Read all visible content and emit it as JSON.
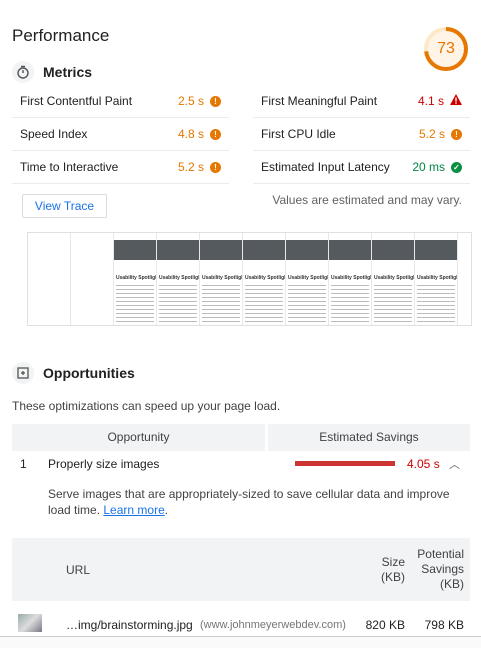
{
  "header": {
    "title": "Performance",
    "score": "73",
    "score_fraction": 0.73,
    "score_color": "#e67700"
  },
  "metrics": {
    "heading": "Metrics",
    "left": [
      {
        "name": "First Contentful Paint",
        "value": "2.5 s",
        "status": "average"
      },
      {
        "name": "Speed Index",
        "value": "4.8 s",
        "status": "average"
      },
      {
        "name": "Time to Interactive",
        "value": "5.2 s",
        "status": "average"
      }
    ],
    "right": [
      {
        "name": "First Meaningful Paint",
        "value": "4.1 s",
        "status": "fail"
      },
      {
        "name": "First CPU Idle",
        "value": "5.2 s",
        "status": "average"
      },
      {
        "name": "Estimated Input Latency",
        "value": "20 ms",
        "status": "pass"
      }
    ],
    "view_trace_label": "View Trace",
    "disclaimer": "Values are estimated and may vary."
  },
  "filmstrip": {
    "frame_title": "Usability Spotlight"
  },
  "opportunities": {
    "heading": "Opportunities",
    "description": "These optimizations can speed up your page load.",
    "col_opportunity": "Opportunity",
    "col_savings": "Estimated Savings",
    "items": [
      {
        "number": "1",
        "name": "Properly size images",
        "savings": "4.05 s",
        "savings_fraction": 1.0,
        "detail_text": "Serve images that are appropriately-sized to save cellular data and improve load time.",
        "learn_more": "Learn more",
        "detail_end": "."
      }
    ],
    "table": {
      "col_url": "URL",
      "col_size_1": "Size",
      "col_size_2": "(KB)",
      "col_potential_1": "Potential",
      "col_potential_2": "Savings",
      "col_potential_3": "(KB)",
      "rows": [
        {
          "path": "…img/brainstorming.jpg",
          "host": "(www.johnmeyerwebdev.com)",
          "size": "820 KB",
          "savings": "798 KB"
        }
      ]
    }
  },
  "colors": {
    "average": "#e67700",
    "fail": "#cc0000",
    "pass": "#018642",
    "link": "#1a73e8"
  }
}
